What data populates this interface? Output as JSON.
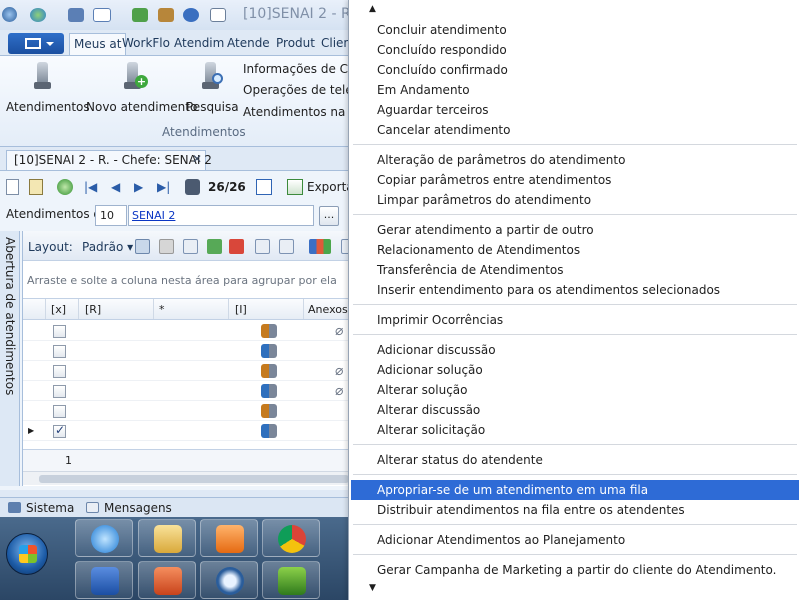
{
  "app": {
    "title": "[10]SENAI 2 - R.",
    "ribbon_tabs": [
      "Meus at",
      "WorkFlo",
      "Atendim",
      "Atende",
      "Produt",
      "Client"
    ],
    "active_tab": "Meus at",
    "buttons": {
      "atendimentos": "Atendimentos",
      "novo": "Novo atendimento",
      "pesquisa": "Pesquisa"
    },
    "ribbon_links": [
      "Informações de Client",
      "Operações de telemar",
      "Atendimentos na Fila"
    ],
    "group_label": "Atendimentos",
    "doc_tab": "[10]SENAI 2 - R. - Chefe: SENAI 2",
    "doc_tab_close": "✕",
    "counter": "26/26",
    "export_label": "Exportar",
    "filter": {
      "label": "Atendimentos de:",
      "code": "10",
      "name": "SENAI 2",
      "button": "..."
    },
    "side_label": "Abertura de atendimentos",
    "grid": {
      "layout_label": "Layout:",
      "padrao_label": "Padrão ▾",
      "group_hint": "Arraste e solte a coluna nesta área para agrupar por ela",
      "columns": [
        "[x]",
        "[R]",
        "*",
        "[I]",
        "Anexos"
      ],
      "rows": [
        {
          "checked": false,
          "attachment": true,
          "current": false
        },
        {
          "checked": false,
          "attachment": false,
          "current": false
        },
        {
          "checked": false,
          "attachment": true,
          "current": false
        },
        {
          "checked": false,
          "attachment": true,
          "current": false
        },
        {
          "checked": false,
          "attachment": false,
          "current": false
        },
        {
          "checked": true,
          "attachment": false,
          "current": true
        }
      ],
      "footer_count": "1"
    },
    "bottom_tabs": [
      "Sistema",
      "Mensagens"
    ]
  },
  "taskbar": {
    "apps": [
      "internet-explorer",
      "file-explorer",
      "media-player",
      "chrome",
      "word",
      "powerpoint",
      "remote-app",
      "camtasia"
    ]
  },
  "context_menu": {
    "scroll_up": "▲",
    "scroll_down": "▼",
    "groups": [
      [
        "Concluir atendimento",
        "Concluído respondido",
        "Concluído confirmado",
        "Em Andamento",
        "Aguardar terceiros",
        "Cancelar atendimento"
      ],
      [
        "Alteração de parâmetros do atendimento",
        "Copiar parâmetros entre atendimentos",
        "Limpar parâmetros do atendimento"
      ],
      [
        "Gerar atendimento a partir de outro",
        "Relacionamento de Atendimentos",
        "Transferência de Atendimentos",
        "Inserir entendimento para os atendimentos selecionados"
      ],
      [
        "Imprimir Ocorrências"
      ],
      [
        "Adicionar discussão",
        "Adicionar solução",
        "Alterar solução",
        "Alterar discussão",
        "Alterar solicitação"
      ],
      [
        "Alterar status do atendente"
      ],
      [
        "Apropriar-se de um atendimento em uma fila",
        "Distribuir atendimentos na fila entre os atendentes"
      ],
      [
        "Adicionar Atendimentos ao Planejamento"
      ],
      [
        "Gerar Campanha de Marketing a partir do cliente do Atendimento."
      ]
    ],
    "highlighted": "Apropriar-se de um atendimento em uma fila"
  },
  "colors": {
    "highlight": "#2e6bd6",
    "ribbon_file": "#1b4fa0",
    "link": "#0b36c4"
  }
}
